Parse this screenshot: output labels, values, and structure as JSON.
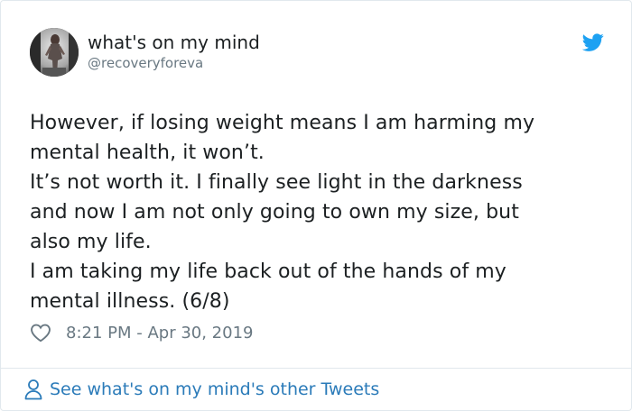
{
  "author": {
    "display_name": "what's on my mind",
    "handle": "@recoveryforeva",
    "avatar_icon": "avatar-photo"
  },
  "tweet": {
    "text": "However, if losing weight means I am harming my\nmental health, it won’t.\nIt’s not worth it. I finally see light in the darkness\nand now I am not only going to own my size, but\nalso my life.\nI am taking my life back out of the hands of my\nmental illness. (6/8)",
    "timestamp": "8:21 PM - Apr 30, 2019"
  },
  "footer": {
    "link_text": "See what's on my mind's other Tweets",
    "icon": "person-icon"
  },
  "colors": {
    "twitter_blue": "#1da1f2",
    "link_blue": "#2b7bb9",
    "secondary_text": "#697882",
    "primary_text": "#1c2022",
    "border": "#e1e8ed"
  }
}
